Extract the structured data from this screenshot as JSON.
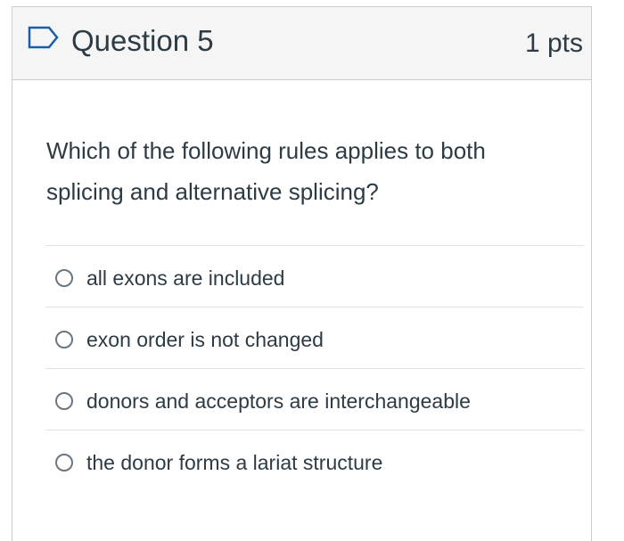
{
  "question": {
    "title": "Question 5",
    "points": "1 pts",
    "flag_icon": "flag-outline-icon",
    "text": "Which of the following rules applies to both splicing and alternative splicing?"
  },
  "answers": [
    {
      "label": "all exons are included",
      "selected": false
    },
    {
      "label": "exon order is not changed",
      "selected": false
    },
    {
      "label": "donors and acceptors are interchangeable",
      "selected": false
    },
    {
      "label": "the donor forms a lariat structure",
      "selected": false
    }
  ],
  "colors": {
    "text": "#2d3b45",
    "header_bg": "#f5f5f5",
    "border": "#c7cdd1",
    "flag": "#1a5ea8"
  }
}
